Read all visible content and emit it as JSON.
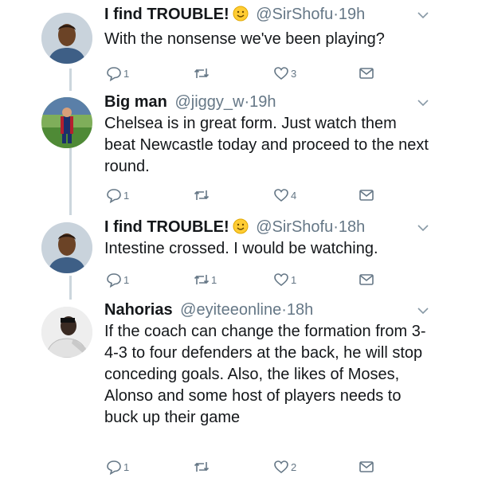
{
  "tweets": [
    {
      "name": "I find TROUBLE!",
      "handle": "@SirShofu",
      "time": "19h",
      "text": "With the nonsense we've been playing?",
      "replies": "1",
      "retweets": "",
      "likes": "3"
    },
    {
      "name": "Big man",
      "handle": "@jiggy_w",
      "time": "19h",
      "text": "Chelsea is in great form. Just watch them beat Newcastle today and proceed to the next round.",
      "replies": "1",
      "retweets": "",
      "likes": "4"
    },
    {
      "name": "I find TROUBLE!",
      "handle": "@SirShofu",
      "time": "18h",
      "text": "Intestine crossed. I would be watching.",
      "replies": "1",
      "retweets": "1",
      "likes": "1"
    },
    {
      "name": "Nahorias",
      "handle": "@eyiteeonline",
      "time": "18h",
      "text": "If the coach can change the formation from 3-4-3 to four defenders at the back, he will stop conceding goals. Also, the likes of Moses,  Alonso and some host of players needs to buck up their game",
      "replies": "1",
      "retweets": "",
      "likes": "2"
    }
  ],
  "separator": "·",
  "colors": {
    "text": "#14171a",
    "secondary": "#657786",
    "thread_line": "#ccd6dd"
  },
  "icons": [
    "reply-icon",
    "retweet-icon",
    "like-icon",
    "direct-message-icon",
    "chevron-down-icon",
    "smiling-emoji-icon"
  ]
}
